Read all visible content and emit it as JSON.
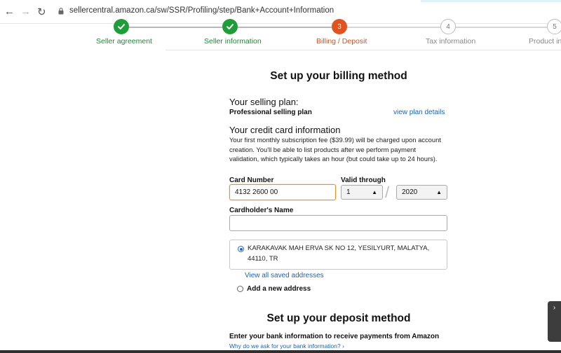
{
  "browser": {
    "url": "sellercentral.amazon.ca/sw/SSR/Profiling/step/Bank+Account+Information"
  },
  "steps": [
    {
      "label": "Seller agreement",
      "state": "done",
      "number": ""
    },
    {
      "label": "Seller information",
      "state": "done",
      "number": ""
    },
    {
      "label": "Billing / Deposit",
      "state": "active",
      "number": "3"
    },
    {
      "label": "Tax information",
      "state": "future",
      "number": "4"
    },
    {
      "label": "Product inf",
      "state": "future",
      "number": "5"
    }
  ],
  "billing": {
    "title": "Set up your billing method",
    "plan_heading": "Your selling plan:",
    "plan_name": "Professional selling plan",
    "view_plan_link": "view plan details",
    "card_heading": "Your credit card information",
    "card_note": "Your first monthly subscription fee ($39.99) will be charged upon account creation. You'll be able to list products after we perform payment validation, which typically takes an hour (but could take up to 24 hours).",
    "card_number_label": "Card Number",
    "card_number_value": "4132 2600 00",
    "valid_through_label": "Valid through",
    "month_value": "1",
    "year_value": "2020",
    "cardholder_label": "Cardholder's Name",
    "cardholder_value": "",
    "address_line1": "KARAKAVAK MAH ERVA SK NO 12, YESILYURT, MALATYA,",
    "address_line2": "44110, TR",
    "view_addresses_link": "View all saved addresses",
    "add_address_label": "Add a new address"
  },
  "deposit": {
    "title": "Set up your deposit method",
    "intro": "Enter your bank information to receive payments from Amazon",
    "why_link": "Why do we ask for your bank information? ›"
  },
  "colors": {
    "done": "#1f9d3a",
    "active": "#e2521e",
    "link": "#1b63b5",
    "focus": "#e8912c"
  }
}
